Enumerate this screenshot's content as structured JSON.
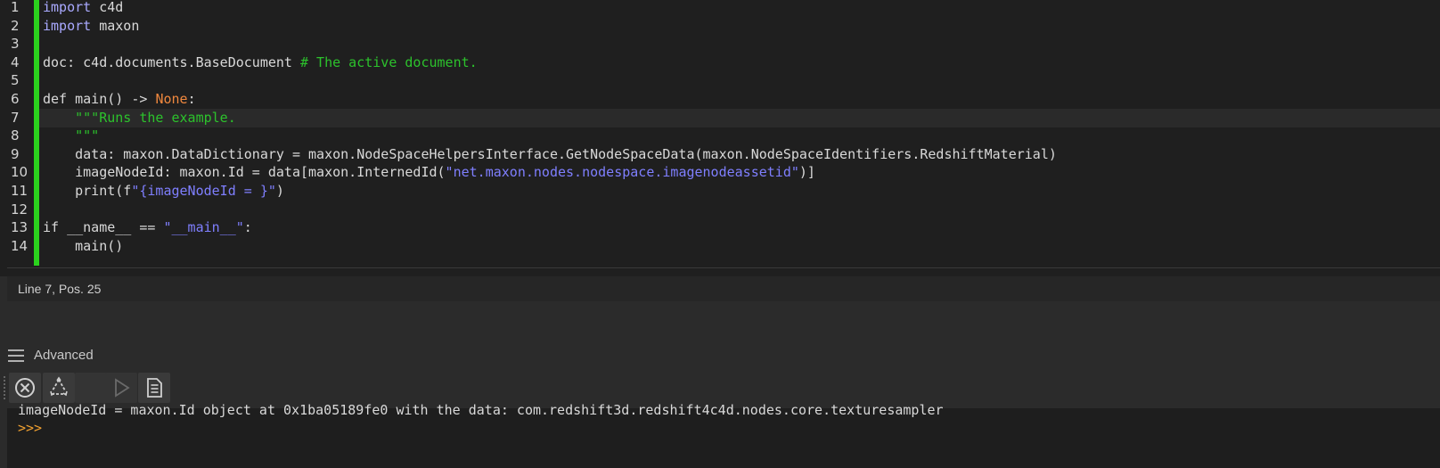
{
  "editor": {
    "line_numbers": [
      "1",
      "2",
      "3",
      "4",
      "5",
      "6",
      "7",
      "8",
      "9",
      "10",
      "11",
      "12",
      "13",
      "14"
    ],
    "lines": [
      [
        {
          "t": "kw",
          "v": "import"
        },
        {
          "t": "txt",
          "v": " c4d"
        }
      ],
      [
        {
          "t": "kw",
          "v": "import"
        },
        {
          "t": "txt",
          "v": " maxon"
        }
      ],
      [],
      [
        {
          "t": "txt",
          "v": "doc: c4d.documents.BaseDocument "
        },
        {
          "t": "cm",
          "v": "# The active document."
        }
      ],
      [],
      [
        {
          "t": "txt",
          "v": "def main() -> "
        },
        {
          "t": "none",
          "v": "None"
        },
        {
          "t": "txt",
          "v": ":"
        }
      ],
      [
        {
          "t": "txt",
          "v": "    "
        },
        {
          "t": "doc",
          "v": "\"\"\"Runs the example."
        }
      ],
      [
        {
          "t": "txt",
          "v": "    "
        },
        {
          "t": "doc",
          "v": "\"\"\""
        }
      ],
      [
        {
          "t": "txt",
          "v": "    data: maxon.DataDictionary = maxon.NodeSpaceHelpersInterface.GetNodeSpaceData(maxon.NodeSpaceIdentifiers.RedshiftMaterial)"
        }
      ],
      [
        {
          "t": "txt",
          "v": "    imageNodeId: maxon.Id = data[maxon.InternedId("
        },
        {
          "t": "str",
          "v": "\"net.maxon.nodes.nodespace.imagenodeassetid\""
        },
        {
          "t": "txt",
          "v": ")]"
        }
      ],
      [
        {
          "t": "txt",
          "v": "    print(f"
        },
        {
          "t": "str",
          "v": "\"{imageNodeId = }\""
        },
        {
          "t": "txt",
          "v": ")"
        }
      ],
      [],
      [
        {
          "t": "txt",
          "v": "if __name__ == "
        },
        {
          "t": "str",
          "v": "\"__main__\""
        },
        {
          "t": "txt",
          "v": ":"
        }
      ],
      [
        {
          "t": "txt",
          "v": "    main()"
        }
      ]
    ],
    "current_line_index": 6
  },
  "status": {
    "position_text": "Line 7, Pos. 25"
  },
  "panel": {
    "title": "Advanced"
  },
  "toolbar": {
    "buttons": [
      {
        "name": "clear-console-button",
        "icon": "circle-x-icon",
        "enabled": true
      },
      {
        "name": "recycle-button",
        "icon": "recycle-icon",
        "enabled": true
      },
      {
        "name": "blank-button",
        "icon": "",
        "enabled": false
      },
      {
        "name": "run-button",
        "icon": "play-icon",
        "enabled": false
      },
      {
        "name": "document-button",
        "icon": "document-icon",
        "enabled": true
      }
    ]
  },
  "console": {
    "output_line": "imageNodeId = maxon.Id object at 0x1ba05189fe0 with the data: com.redshift3d.redshift4c4d.nodes.core.texturesampler",
    "prompt": ">>>"
  },
  "colors": {
    "change_bar": "#2bd21d",
    "keyword": "#a9a9ff",
    "comment": "#2cc22c",
    "string": "#7f7fff",
    "none_const": "#f0883e",
    "prompt": "#f0a030"
  }
}
